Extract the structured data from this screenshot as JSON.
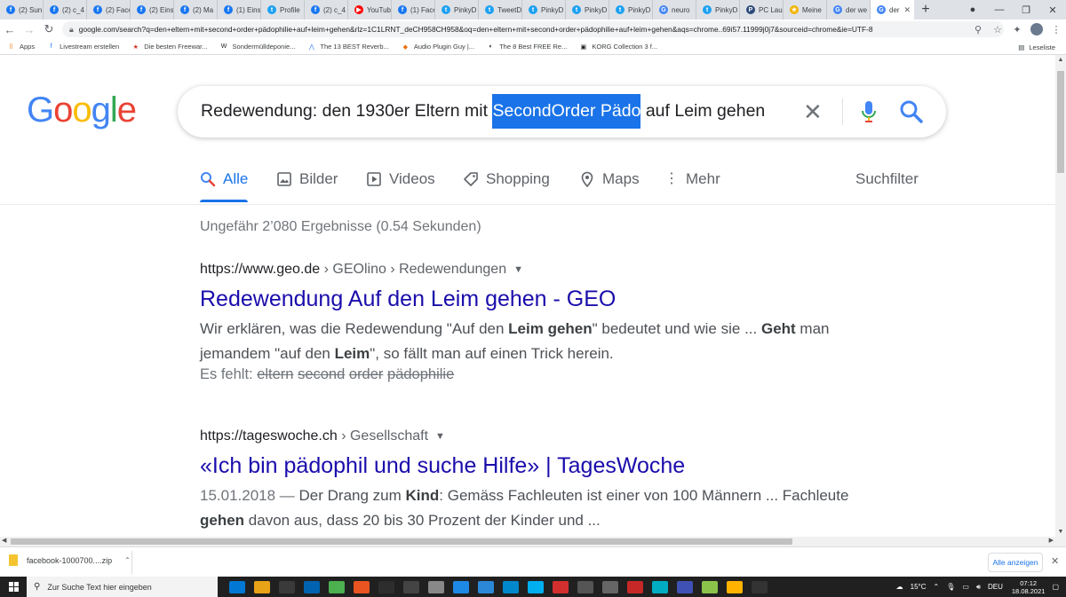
{
  "browser": {
    "tabs": [
      {
        "label": "(2) Sun",
        "icon": "facebook-icon",
        "color": "#1877f2"
      },
      {
        "label": "(2) c_4",
        "icon": "facebook-icon",
        "color": "#1877f2"
      },
      {
        "label": "(2) Face",
        "icon": "facebook-icon",
        "color": "#1877f2"
      },
      {
        "label": "(2) Eins",
        "icon": "facebook-icon",
        "color": "#1877f2"
      },
      {
        "label": "(2) Ma",
        "icon": "facebook-icon",
        "color": "#1877f2"
      },
      {
        "label": "(1) Eins",
        "icon": "facebook-icon",
        "color": "#1877f2"
      },
      {
        "label": "Profile",
        "icon": "twitter-icon",
        "color": "#1da1f2"
      },
      {
        "label": "(2) c_4",
        "icon": "facebook-icon",
        "color": "#1877f2"
      },
      {
        "label": "YouTub",
        "icon": "youtube-icon",
        "color": "#ff0000"
      },
      {
        "label": "(1) Face",
        "icon": "facebook-icon",
        "color": "#1877f2"
      },
      {
        "label": "PinkyD",
        "icon": "twitter-icon",
        "color": "#1da1f2"
      },
      {
        "label": "TweetD",
        "icon": "tweetdeck-icon",
        "color": "#1da1f2"
      },
      {
        "label": "PinkyD",
        "icon": "twitter-icon",
        "color": "#1da1f2"
      },
      {
        "label": "PinkyD",
        "icon": "twitter-icon",
        "color": "#1da1f2"
      },
      {
        "label": "PinkyD",
        "icon": "twitter-icon",
        "color": "#1da1f2"
      },
      {
        "label": "neuro",
        "icon": "google-icon",
        "color": "#4285f4"
      },
      {
        "label": "PinkyD",
        "icon": "twitter-icon",
        "color": "#1da1f2"
      },
      {
        "label": "PC Lau",
        "icon": "pc-icon",
        "color": "#2b4a7a"
      },
      {
        "label": "Meine",
        "icon": "star-icon",
        "color": "#f4b400"
      },
      {
        "label": "der we",
        "icon": "google-icon",
        "color": "#4285f4"
      },
      {
        "label": "der",
        "icon": "google-icon",
        "color": "#4285f4",
        "active": true
      }
    ],
    "url": "google.com/search?q=den+eltern+mit+second+order+pädophilie+auf+leim+gehen&rlz=1C1LRNT_deCH958CH958&oq=den+eltern+mit+second+order+pädophilie+auf+leim+gehen&aqs=chrome..69i57.11999j0j7&sourceid=chrome&ie=UTF-8",
    "bookmarks": [
      {
        "label": "Apps",
        "icon": "apps-grid-icon"
      },
      {
        "label": "Livestream erstellen",
        "icon": "facebook-icon"
      },
      {
        "label": "Die besten Freewar...",
        "icon": "star-icon"
      },
      {
        "label": "Sondermülldeponie...",
        "icon": "w-icon"
      },
      {
        "label": "The 13 BEST Reverb...",
        "icon": "audio-icon"
      },
      {
        "label": "Audio Plugin Guy |...",
        "icon": "plugin-icon"
      },
      {
        "label": "The 8 Best FREE Re...",
        "icon": "bookmark-icon"
      },
      {
        "label": "KORG Collection 3 f...",
        "icon": "korg-icon"
      }
    ],
    "reading_list": "Leseliste"
  },
  "search": {
    "query_before": "Redewendung: den 1930er Eltern mit ",
    "query_selected": "SecondOrder Pädo",
    "query_after": " auf Leim gehen"
  },
  "tabs": {
    "all": "Alle",
    "images": "Bilder",
    "videos": "Videos",
    "shopping": "Shopping",
    "maps": "Maps",
    "more": "Mehr",
    "tools": "Suchfilter"
  },
  "stats": "Ungefähr 2’080 Ergebnisse (0.54 Sekunden)",
  "results": [
    {
      "domain": "https://www.geo.de",
      "crumbs": " › GEOlino › Redewendungen",
      "title": "Redewendung Auf den Leim gehen - GEO",
      "snippet_html": "Wir erklären, was die Redewendung \"Auf den <b>Leim gehen</b>\" bedeutet und wie sie ... <b>Geht</b> man jemandem \"auf den <b>Leim</b>\", so fällt man auf einen Trick herein.",
      "missing_label": "Es fehlt: ",
      "missing_terms": [
        "eltern",
        "second",
        "order",
        "pädophilie"
      ]
    },
    {
      "domain": "https://tageswoche.ch",
      "crumbs": " › Gesellschaft",
      "title": "«Ich bin pädophil und suche Hilfe» | TagesWoche",
      "date": "15.01.2018 — ",
      "snippet_html": "Der Drang zum <b>Kind</b>: Gemäss Fachleuten ist einer von 100 Männern ... Fachleute <b>gehen</b> davon aus, dass 20 bis 30 Prozent der Kinder und ..."
    }
  ],
  "download": {
    "filename": "facebook-1000700....zip",
    "show_all": "Alle anzeigen"
  },
  "taskbar": {
    "search_placeholder": "Zur Suche Text hier eingeben",
    "temperature": "15°C",
    "language": "DEU",
    "time": "07:12",
    "date": "18.08.2021",
    "app_colors": [
      "#0078d4",
      "#e8a317",
      "#3a3a3a",
      "#0063b1",
      "#4caf50",
      "#e95420",
      "#2d2d2d",
      "#444",
      "#888",
      "#1e88e5",
      "#2b88d8",
      "#0088cc",
      "#00aff0",
      "#d32f2f",
      "#555",
      "#666",
      "#c62828",
      "#00acc1",
      "#3f51b5",
      "#8bc34a",
      "#ffb300",
      "#333"
    ]
  }
}
